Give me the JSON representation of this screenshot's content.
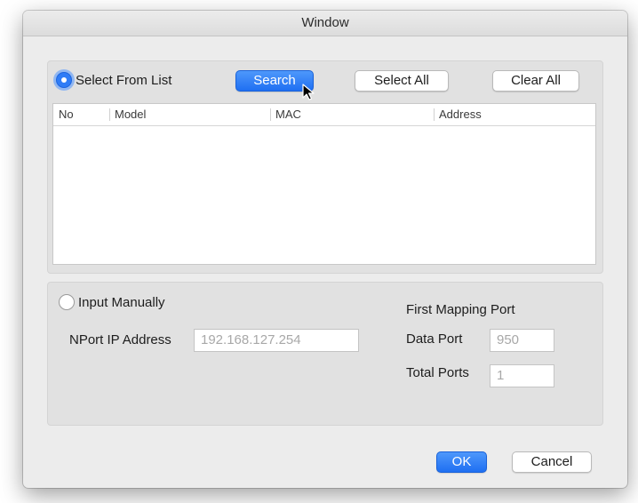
{
  "window": {
    "title": "Window"
  },
  "select_from_list": {
    "radio_label": "Select From List",
    "selected": true,
    "search_label": "Search",
    "select_all_label": "Select All",
    "clear_all_label": "Clear All",
    "table": {
      "columns": [
        "No",
        "Model",
        "MAC",
        "Address"
      ],
      "rows": []
    }
  },
  "input_manually": {
    "radio_label": "Input Manually",
    "selected": false,
    "ip_label": "NPort IP Address",
    "ip_placeholder": "192.168.127.254",
    "mapping_title": "First Mapping Port",
    "data_port_label": "Data Port",
    "data_port_placeholder": "950",
    "total_ports_label": "Total Ports",
    "total_ports_placeholder": "1"
  },
  "footer": {
    "ok_label": "OK",
    "cancel_label": "Cancel"
  },
  "colors": {
    "accent": "#2f7cf6",
    "window_bg": "#ececec",
    "group_bg": "#e1e1e1"
  }
}
